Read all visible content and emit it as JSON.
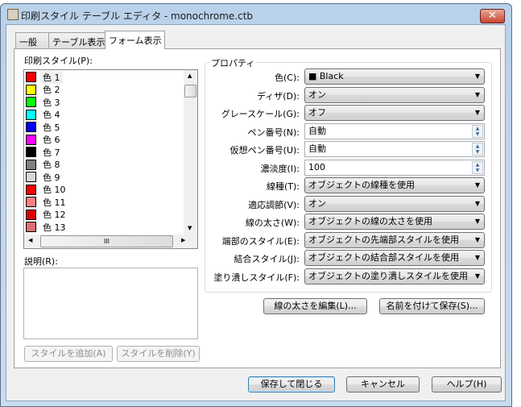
{
  "window": {
    "title": "印刷スタイル テーブル エディタ - monochrome.ctb",
    "close_icon": "close-icon"
  },
  "tabs": [
    {
      "label": "一般"
    },
    {
      "label": "テーブル表示"
    },
    {
      "label": "フォーム表示",
      "selected": true
    }
  ],
  "styles": {
    "label": "印刷スタイル(P):",
    "items": [
      {
        "label": "色 1",
        "color": "#ff0000"
      },
      {
        "label": "色 2",
        "color": "#ffff00"
      },
      {
        "label": "色 3",
        "color": "#00ff00"
      },
      {
        "label": "色 4",
        "color": "#00ffff"
      },
      {
        "label": "色 5",
        "color": "#0000ff"
      },
      {
        "label": "色 6",
        "color": "#ff00ff"
      },
      {
        "label": "色 7",
        "color": "#000000"
      },
      {
        "label": "色 8",
        "color": "#808080"
      },
      {
        "label": "色 9",
        "color": "#d8d8d8"
      },
      {
        "label": "色 10",
        "color": "#ff0000"
      },
      {
        "label": "色 11",
        "color": "#ff8080"
      },
      {
        "label": "色 12",
        "color": "#dd0000"
      },
      {
        "label": "色 13",
        "color": "#dd7070"
      }
    ],
    "selected_index": 0
  },
  "description": {
    "label": "説明(R):",
    "value": ""
  },
  "buttons": {
    "add_style": "スタイルを追加(A)",
    "delete_style": "スタイルを削除(Y)",
    "edit_lineweights": "線の太さを編集(L)...",
    "save_as": "名前を付けて保存(S)...",
    "save_close": "保存して閉じる",
    "cancel": "キャンセル",
    "help": "ヘルプ(H)"
  },
  "properties": {
    "label": "プロパティ",
    "fields": [
      {
        "label": "色(C):",
        "value": "■ Black",
        "type": "combo"
      },
      {
        "label": "ディザ(D):",
        "value": "オン",
        "type": "combo"
      },
      {
        "label": "グレースケール(G):",
        "value": "オフ",
        "type": "combo"
      },
      {
        "label": "ペン番号(N):",
        "value": "自動",
        "type": "spin"
      },
      {
        "label": "仮想ペン番号(U):",
        "value": "自動",
        "type": "spin"
      },
      {
        "label": "濃淡度(I):",
        "value": "100",
        "type": "spin"
      },
      {
        "label": "線種(T):",
        "value": "オブジェクトの線種を使用",
        "type": "combo"
      },
      {
        "label": "適応調節(V):",
        "value": "オン",
        "type": "combo"
      },
      {
        "label": "線の太さ(W):",
        "value": "オブジェクトの線の太さを使用",
        "type": "combo"
      },
      {
        "label": "端部のスタイル(E):",
        "value": "オブジェクトの先端部スタイルを使用",
        "type": "combo"
      },
      {
        "label": "結合スタイル(J):",
        "value": "オブジェクトの結合部スタイルを使用",
        "type": "combo"
      },
      {
        "label": "塗り潰しスタイル(F):",
        "value": "オブジェクトの塗り潰しスタイルを使用",
        "type": "combo"
      }
    ]
  }
}
